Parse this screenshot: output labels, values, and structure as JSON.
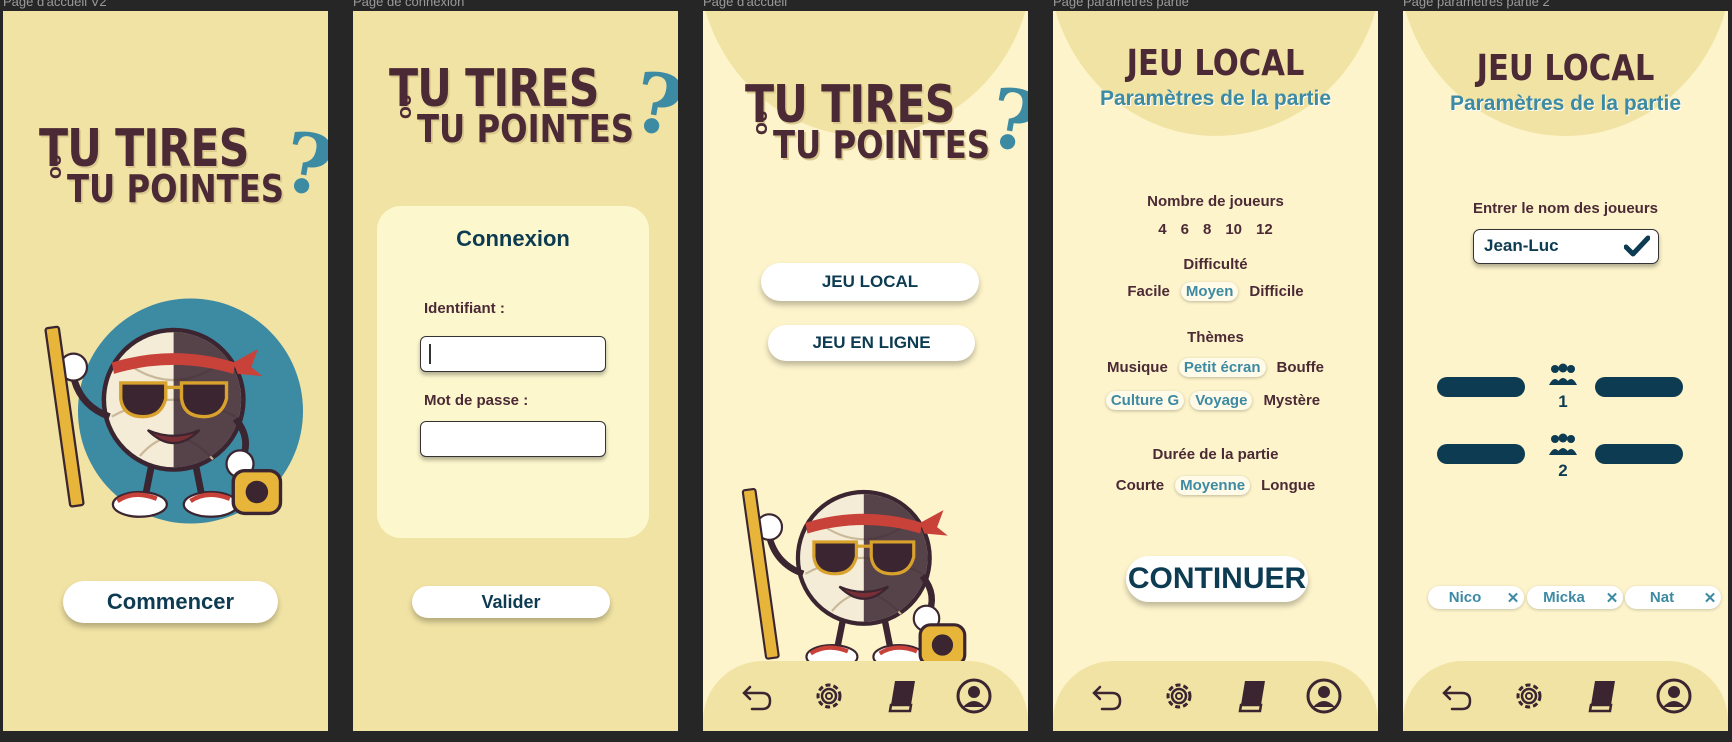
{
  "frames": [
    {
      "label": "Page d'accueil V2"
    },
    {
      "label": "Page de connexion"
    },
    {
      "label": "Page d'accueil"
    },
    {
      "label": "Page paramètres partie"
    },
    {
      "label": "Page paramètres  partie 2"
    }
  ],
  "logo": {
    "line1": "TU TIRES",
    "ou": "OU",
    "line2": "TU POINTES",
    "question": "?"
  },
  "start": {
    "button": "Commencer"
  },
  "login": {
    "title": "Connexion",
    "id_label": "Identifiant :",
    "pw_label": "Mot de passe :",
    "submit": "Valider"
  },
  "home": {
    "local_button": "JEU LOCAL",
    "online_button": "JEU EN LIGNE"
  },
  "settings": {
    "title": "JEU LOCAL",
    "subtitle": "Paramètres de la partie",
    "players_label": "Nombre de joueurs",
    "players": [
      "4",
      "6",
      "8",
      "10",
      "12"
    ],
    "difficulty_label": "Difficulté",
    "difficulty": [
      {
        "label": "Facile",
        "selected": false
      },
      {
        "label": "Moyen",
        "selected": true
      },
      {
        "label": "Difficile",
        "selected": false
      }
    ],
    "themes_label": "Thèmes",
    "themes_row1": [
      {
        "label": "Musique",
        "selected": false
      },
      {
        "label": "Petit écran",
        "selected": true
      },
      {
        "label": "Bouffe",
        "selected": false
      }
    ],
    "themes_row2": [
      {
        "label": "Culture G",
        "selected": true
      },
      {
        "label": "Voyage",
        "selected": true
      },
      {
        "label": "Mystère",
        "selected": false
      }
    ],
    "duration_label": "Durée de la partie",
    "duration": [
      {
        "label": "Courte",
        "selected": false
      },
      {
        "label": "Moyenne",
        "selected": true
      },
      {
        "label": "Longue",
        "selected": false
      }
    ],
    "continue": "CONTINUER"
  },
  "settings2": {
    "title": "JEU LOCAL",
    "subtitle": "Paramètres de la partie",
    "names_label": "Entrer le nom des joueurs",
    "name_value": "Jean-Luc",
    "team1": "1",
    "team2": "2",
    "chips": [
      "Nico",
      "Micka",
      "Nat"
    ]
  },
  "colors": {
    "accent": "#3d8aa3",
    "dark": "#4b2a35",
    "navy": "#0d3b52",
    "bg": "#f1e3a4"
  },
  "tabbar_icons": [
    "back-arrow-icon",
    "gear-icon",
    "book-icon",
    "profile-icon"
  ]
}
